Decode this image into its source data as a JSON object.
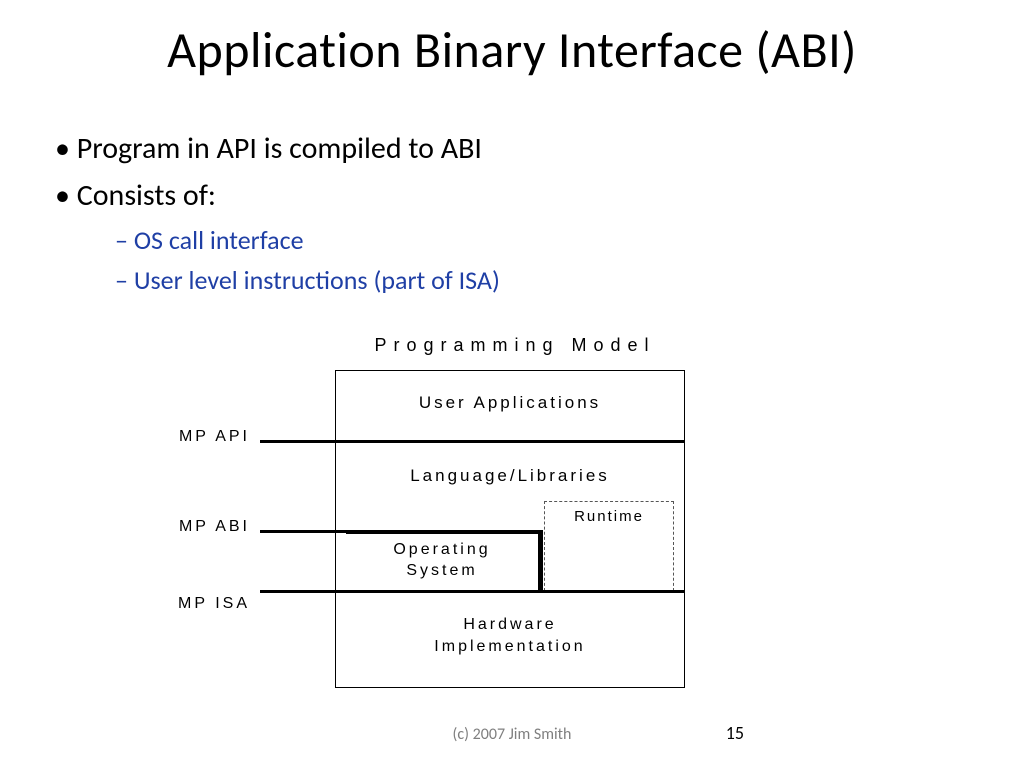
{
  "title": "Application Binary Interface (ABI)",
  "bullets": {
    "b1": "Program in API is compiled to ABI",
    "b2": "Consists of:",
    "s1": "OS call interface",
    "s2": "User level instructions (part of ISA)"
  },
  "diagram": {
    "heading": "Programming Model",
    "layers": {
      "user_apps": "User Applications",
      "lang_libs": "Language/Libraries",
      "runtime": "Runtime",
      "os_l1": "Operating",
      "os_l2": "System",
      "hw_l1": "Hardware",
      "hw_l2": "Implementation"
    },
    "mp_labels": {
      "api": "MP API",
      "abi": "MP ABI",
      "isa": "MP ISA"
    }
  },
  "footer": {
    "copyright": "(c) 2007 Jim Smith",
    "page": "15"
  }
}
